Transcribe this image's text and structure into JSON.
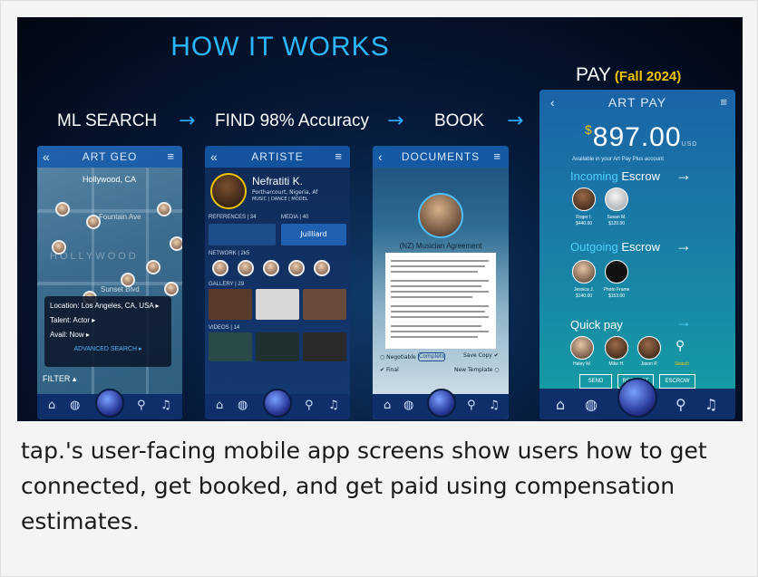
{
  "hero": {
    "title": "HOW IT WORKS",
    "steps": [
      "ML SEARCH",
      "FIND 98% Accuracy",
      "BOOK"
    ],
    "pay_title": "PAY",
    "pay_subtitle": "(Fall 2024)"
  },
  "phone_geo": {
    "header": "ART GEO",
    "city": "Hollywood, CA",
    "map_labels": [
      "Fountain Ave",
      "HOLLYWOOD",
      "Sunset Blvd"
    ],
    "location": "Location: Los Angeles, CA, USA",
    "talent": "Talent: Actor",
    "avail": "Avail: Now",
    "advanced": "ADVANCED SEARCH",
    "filter": "FILTER"
  },
  "phone_artiste": {
    "header": "ARTISTE",
    "name": "Nefratiti K.",
    "location": "Portharcourt, Nigeria, Af",
    "tags": "MUSIC | DANCE | MODEL",
    "sections": [
      "REFERENCES | 34",
      "MEDIA | 40",
      "NETWORK | 2k5",
      "GALLERY | 29",
      "VIDEOS | 14"
    ],
    "school": "Juilliard"
  },
  "phone_docs": {
    "header": "DOCUMENTS",
    "agreement": "(NZ) Musician Agreement",
    "negotiable": "Negotiable",
    "complete": "Complete",
    "save_copy": "Save Copy",
    "final": "Final",
    "new_template": "New Template"
  },
  "phone_pay": {
    "header": "ART PAY",
    "currency": "$",
    "amount": "897.00",
    "currency_code": "USD",
    "available": "Available in your Art Pay Plus account",
    "incoming": [
      "Incoming",
      "Escrow"
    ],
    "outgoing": [
      "Outgoing",
      "Escrow"
    ],
    "quick": "Quick pay",
    "incoming_people": [
      {
        "name": "Roger I.",
        "amt": "$440.00"
      },
      {
        "name": "Susan M.",
        "amt": "$120.00"
      }
    ],
    "outgoing_people": [
      {
        "name": "Jessica J.",
        "amt": "$140.00"
      },
      {
        "name": "Photo Frame",
        "amt": "$153.00"
      }
    ],
    "quick_people": [
      "Haley W.",
      "Mike H.",
      "Jason P.",
      "Search"
    ],
    "buttons": [
      "SEND",
      "REQUEST",
      "ESCROW"
    ]
  },
  "caption": "tap.'s user-facing mobile app screens show users how to get connected, get booked, and get paid using compensation estimates.",
  "colors": {
    "accent": "#2bb6ff",
    "gold": "#f2c400"
  }
}
